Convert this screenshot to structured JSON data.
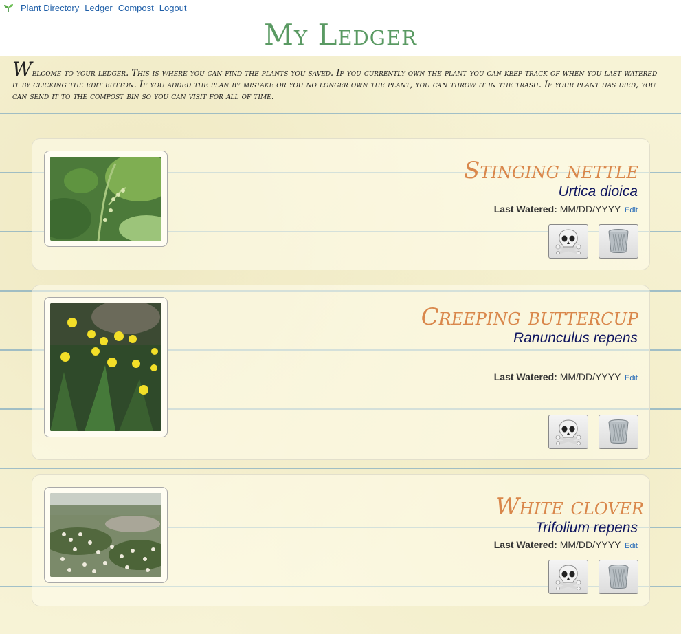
{
  "nav": {
    "links": [
      "Plant Directory",
      "Ledger",
      "Compost",
      "Logout"
    ]
  },
  "title": "My Ledger",
  "intro": "Welcome to your ledger. This is where you can find the plants you saved. If you currently own the plant you can keep track of when you last watered it by clicking the edit button. If you added the plan by mistake or you no longer own the plant, you can throw it in the trash. If your plant has died, you can send it to the compost bin so you can visit for all of time.",
  "plants": [
    {
      "common": "Stinging nettle",
      "scientific": "Urtica dioica",
      "watered_label": "Last Watered:",
      "watered_value": "MM/DD/YYYY",
      "edit": "Edit"
    },
    {
      "common": "Creeping buttercup",
      "scientific": "Ranunculus repens",
      "watered_label": "Last Watered:",
      "watered_value": "MM/DD/YYYY",
      "edit": "Edit"
    },
    {
      "common": "White clover",
      "scientific": "Trifolium repens",
      "watered_label": "Last Watered:",
      "watered_value": "MM/DD/YYYY",
      "edit": "Edit"
    }
  ],
  "icons": {
    "logo": "sprout-icon",
    "compost": "skull-and-crossbones-icon",
    "trash": "trash-can-icon"
  },
  "colors": {
    "title": "#5a9a63",
    "common_name": "#d9874b",
    "scientific_name": "#101660",
    "link": "#1f5fa8"
  }
}
